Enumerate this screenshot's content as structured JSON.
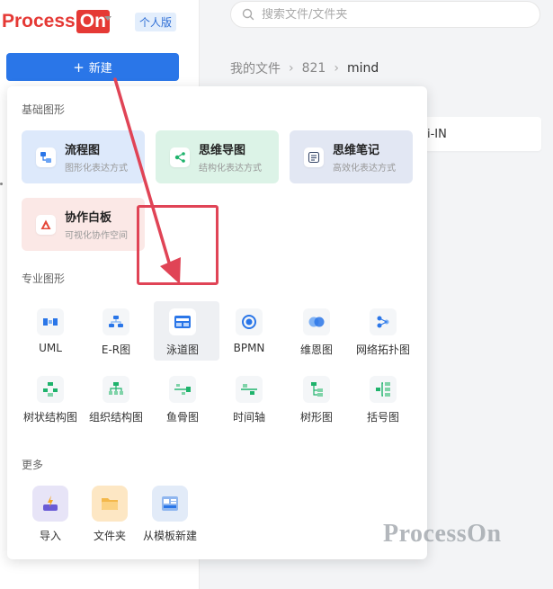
{
  "app": {
    "logo_left": "Process",
    "logo_right": "On",
    "edition": "个人版",
    "new_button": "新建"
  },
  "search": {
    "placeholder": "搜索文件/文件夹"
  },
  "breadcrumb": [
    "我的文件",
    "821",
    "mind"
  ],
  "file_card_label": "i-IN",
  "popup": {
    "basic_title": "基础图形",
    "basic": [
      {
        "name": "流程图",
        "desc": "图形化表达方式",
        "bg": "#dde9fb",
        "icon": "flowchart-icon"
      },
      {
        "name": "思维导图",
        "desc": "结构化表达方式",
        "bg": "#dcf3e7",
        "icon": "mindmap-icon"
      },
      {
        "name": "思维笔记",
        "desc": "高效化表达方式",
        "bg": "#e2e7f3",
        "icon": "mindnote-icon"
      },
      {
        "name": "协作白板",
        "desc": "可视化协作空间",
        "bg": "#fbe8e6",
        "icon": "whiteboard-icon"
      }
    ],
    "pro_title": "专业图形",
    "pro": [
      {
        "label": "UML",
        "icon": "uml-icon"
      },
      {
        "label": "E-R图",
        "icon": "er-icon"
      },
      {
        "label": "泳道图",
        "icon": "swimlane-icon"
      },
      {
        "label": "BPMN",
        "icon": "bpmn-icon"
      },
      {
        "label": "维恩图",
        "icon": "venn-icon"
      },
      {
        "label": "网络拓扑图",
        "icon": "network-icon"
      },
      {
        "label": "树状结构图",
        "icon": "tree-structure-icon"
      },
      {
        "label": "组织结构图",
        "icon": "org-chart-icon"
      },
      {
        "label": "鱼骨图",
        "icon": "fishbone-icon"
      },
      {
        "label": "时间轴",
        "icon": "timeline-icon"
      },
      {
        "label": "树形图",
        "icon": "tree-diagram-icon"
      },
      {
        "label": "括号图",
        "icon": "bracket-icon"
      }
    ],
    "more_title": "更多",
    "more": [
      {
        "label": "导入",
        "icon": "import-icon",
        "bg": "#e7e4f7"
      },
      {
        "label": "文件夹",
        "icon": "folder-icon",
        "bg": "#fde7c4"
      },
      {
        "label": "从模板新建",
        "icon": "template-icon",
        "bg": "#e2ebf8"
      }
    ]
  },
  "colors": {
    "accent": "#2a76e8",
    "highlight": "#e04456",
    "brand_red": "#e53935"
  },
  "watermark": "ProcessOn"
}
